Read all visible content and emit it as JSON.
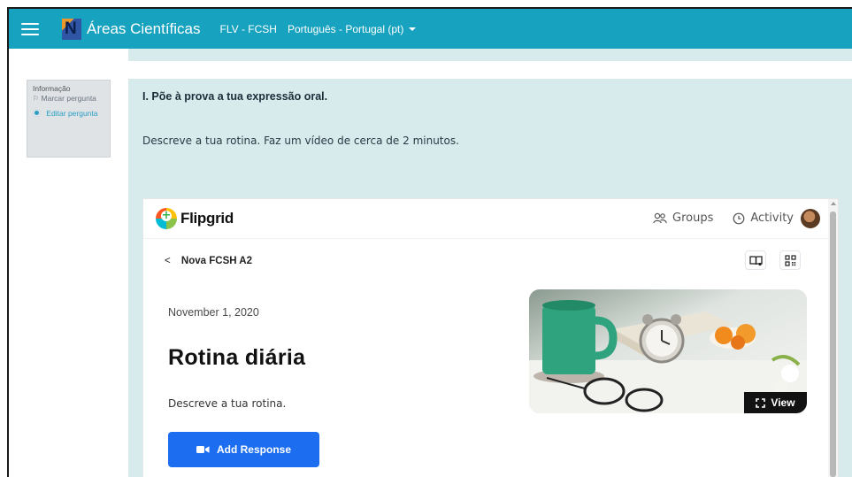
{
  "navbar": {
    "site_name": "Áreas Científicas",
    "course_link": "FLV - FCSH",
    "language": "Português - Portugal (pt)",
    "color": "#17a2c0"
  },
  "question_info": {
    "label": "Informação",
    "flag_label": "Marcar pergunta",
    "edit_label": "Editar pergunta"
  },
  "question": {
    "title": "I. Põe à prova a tua expressão oral.",
    "text": "Descreve a tua rotina. Faz um vídeo de cerca de 2 minutos."
  },
  "flipgrid": {
    "brand": "Flipgrid",
    "nav": {
      "groups": "Groups",
      "activity": "Activity"
    },
    "back_label": "Nova FCSH A2",
    "date": "November 1, 2020",
    "topic_title": "Rotina diária",
    "topic_description": "Descreve a tua rotina.",
    "add_response_label": "Add Response",
    "view_label": "View",
    "accent": "#1c6df0"
  },
  "icons": [
    "menu-icon",
    "flag-icon",
    "gear-icon",
    "groups-icon",
    "clock-icon",
    "avatar",
    "chevron-left-icon",
    "immersive-reader-icon",
    "qr-code-icon",
    "expand-icon",
    "video-camera-icon"
  ]
}
